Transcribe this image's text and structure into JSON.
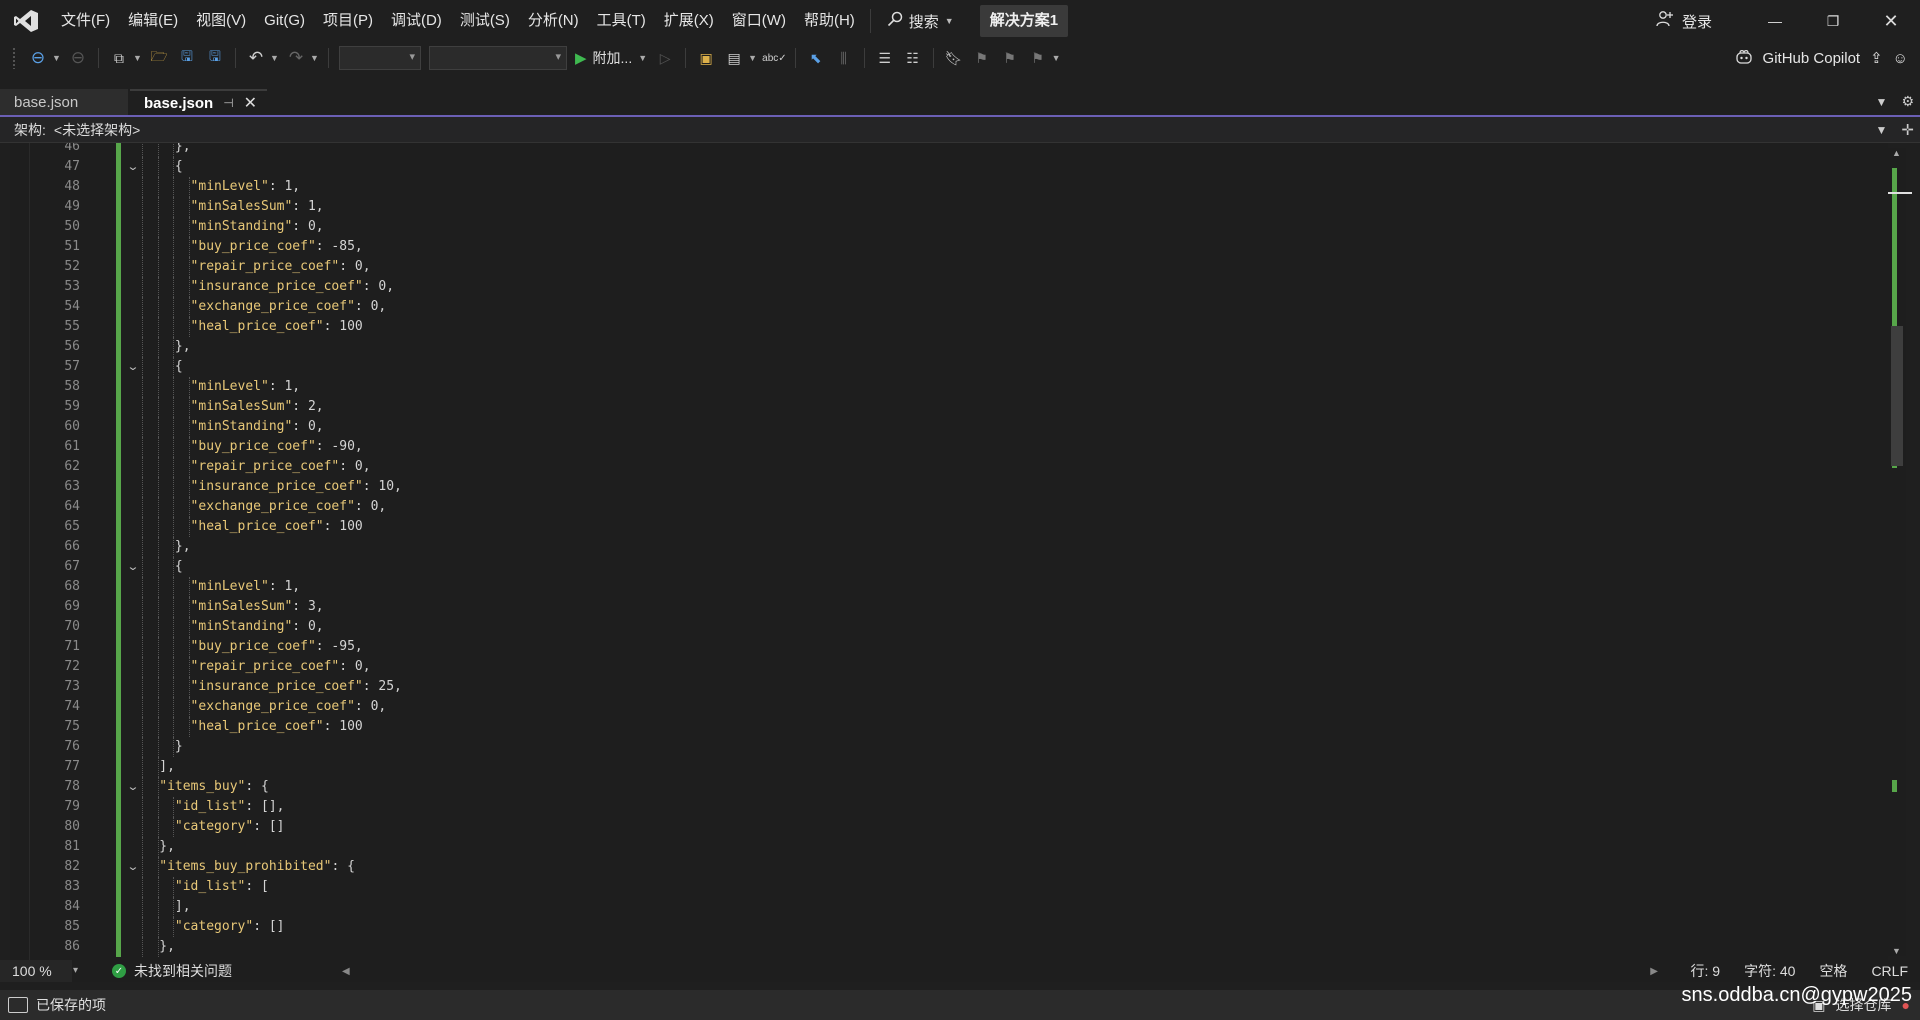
{
  "menu": {
    "items": [
      "文件(F)",
      "编辑(E)",
      "视图(V)",
      "Git(G)",
      "项目(P)",
      "调试(D)",
      "测试(S)",
      "分析(N)",
      "工具(T)",
      "扩展(X)",
      "窗口(W)",
      "帮助(H)"
    ],
    "search_label": "搜索",
    "solution_name": "解决方案1",
    "login_label": "登录"
  },
  "toolbar": {
    "attach_label": "附加...",
    "copilot_label": "GitHub Copilot"
  },
  "tabs": [
    {
      "label": "base.json",
      "active": false
    },
    {
      "label": "base.json",
      "active": true
    }
  ],
  "navbar": {
    "label": "架构:",
    "value": "<未选择架构>"
  },
  "editor": {
    "lines": [
      {
        "n": "46",
        "depth": 3,
        "fold": false,
        "tokens": [
          [
            "p",
            "},"
          ]
        ]
      },
      {
        "n": "47",
        "depth": 3,
        "fold": true,
        "tokens": [
          [
            "p",
            "{"
          ]
        ]
      },
      {
        "n": "48",
        "depth": 4,
        "fold": false,
        "tokens": [
          [
            "s",
            "\"minLevel\""
          ],
          [
            "p",
            ": 1,"
          ]
        ]
      },
      {
        "n": "49",
        "depth": 4,
        "fold": false,
        "tokens": [
          [
            "s",
            "\"minSalesSum\""
          ],
          [
            "p",
            ": 1,"
          ]
        ]
      },
      {
        "n": "50",
        "depth": 4,
        "fold": false,
        "tokens": [
          [
            "s",
            "\"minStanding\""
          ],
          [
            "p",
            ": 0,"
          ]
        ]
      },
      {
        "n": "51",
        "depth": 4,
        "fold": false,
        "tokens": [
          [
            "s",
            "\"buy_price_coef\""
          ],
          [
            "p",
            ": -85,"
          ]
        ]
      },
      {
        "n": "52",
        "depth": 4,
        "fold": false,
        "tokens": [
          [
            "s",
            "\"repair_price_coef\""
          ],
          [
            "p",
            ": 0,"
          ]
        ]
      },
      {
        "n": "53",
        "depth": 4,
        "fold": false,
        "tokens": [
          [
            "s",
            "\"insurance_price_coef\""
          ],
          [
            "p",
            ": 0,"
          ]
        ]
      },
      {
        "n": "54",
        "depth": 4,
        "fold": false,
        "tokens": [
          [
            "s",
            "\"exchange_price_coef\""
          ],
          [
            "p",
            ": 0,"
          ]
        ]
      },
      {
        "n": "55",
        "depth": 4,
        "fold": false,
        "tokens": [
          [
            "s",
            "\"heal_price_coef\""
          ],
          [
            "p",
            ": 100"
          ]
        ]
      },
      {
        "n": "56",
        "depth": 3,
        "fold": false,
        "tokens": [
          [
            "p",
            "},"
          ]
        ]
      },
      {
        "n": "57",
        "depth": 3,
        "fold": true,
        "tokens": [
          [
            "p",
            "{"
          ]
        ]
      },
      {
        "n": "58",
        "depth": 4,
        "fold": false,
        "tokens": [
          [
            "s",
            "\"minLevel\""
          ],
          [
            "p",
            ": 1,"
          ]
        ]
      },
      {
        "n": "59",
        "depth": 4,
        "fold": false,
        "tokens": [
          [
            "s",
            "\"minSalesSum\""
          ],
          [
            "p",
            ": 2,"
          ]
        ]
      },
      {
        "n": "60",
        "depth": 4,
        "fold": false,
        "tokens": [
          [
            "s",
            "\"minStanding\""
          ],
          [
            "p",
            ": 0,"
          ]
        ]
      },
      {
        "n": "61",
        "depth": 4,
        "fold": false,
        "tokens": [
          [
            "s",
            "\"buy_price_coef\""
          ],
          [
            "p",
            ": -90,"
          ]
        ]
      },
      {
        "n": "62",
        "depth": 4,
        "fold": false,
        "tokens": [
          [
            "s",
            "\"repair_price_coef\""
          ],
          [
            "p",
            ": 0,"
          ]
        ]
      },
      {
        "n": "63",
        "depth": 4,
        "fold": false,
        "tokens": [
          [
            "s",
            "\"insurance_price_coef\""
          ],
          [
            "p",
            ": 10,"
          ]
        ]
      },
      {
        "n": "64",
        "depth": 4,
        "fold": false,
        "tokens": [
          [
            "s",
            "\"exchange_price_coef\""
          ],
          [
            "p",
            ": 0,"
          ]
        ]
      },
      {
        "n": "65",
        "depth": 4,
        "fold": false,
        "tokens": [
          [
            "s",
            "\"heal_price_coef\""
          ],
          [
            "p",
            ": 100"
          ]
        ]
      },
      {
        "n": "66",
        "depth": 3,
        "fold": false,
        "tokens": [
          [
            "p",
            "},"
          ]
        ]
      },
      {
        "n": "67",
        "depth": 3,
        "fold": true,
        "tokens": [
          [
            "p",
            "{"
          ]
        ]
      },
      {
        "n": "68",
        "depth": 4,
        "fold": false,
        "tokens": [
          [
            "s",
            "\"minLevel\""
          ],
          [
            "p",
            ": 1,"
          ]
        ]
      },
      {
        "n": "69",
        "depth": 4,
        "fold": false,
        "tokens": [
          [
            "s",
            "\"minSalesSum\""
          ],
          [
            "p",
            ": 3,"
          ]
        ]
      },
      {
        "n": "70",
        "depth": 4,
        "fold": false,
        "tokens": [
          [
            "s",
            "\"minStanding\""
          ],
          [
            "p",
            ": 0,"
          ]
        ]
      },
      {
        "n": "71",
        "depth": 4,
        "fold": false,
        "tokens": [
          [
            "s",
            "\"buy_price_coef\""
          ],
          [
            "p",
            ": -95,"
          ]
        ]
      },
      {
        "n": "72",
        "depth": 4,
        "fold": false,
        "tokens": [
          [
            "s",
            "\"repair_price_coef\""
          ],
          [
            "p",
            ": 0,"
          ]
        ]
      },
      {
        "n": "73",
        "depth": 4,
        "fold": false,
        "tokens": [
          [
            "s",
            "\"insurance_price_coef\""
          ],
          [
            "p",
            ": 25,"
          ]
        ]
      },
      {
        "n": "74",
        "depth": 4,
        "fold": false,
        "tokens": [
          [
            "s",
            "\"exchange_price_coef\""
          ],
          [
            "p",
            ": 0,"
          ]
        ]
      },
      {
        "n": "75",
        "depth": 4,
        "fold": false,
        "tokens": [
          [
            "s",
            "\"heal_price_coef\""
          ],
          [
            "p",
            ": 100"
          ]
        ]
      },
      {
        "n": "76",
        "depth": 3,
        "fold": false,
        "tokens": [
          [
            "p",
            "}"
          ]
        ]
      },
      {
        "n": "77",
        "depth": 2,
        "fold": false,
        "tokens": [
          [
            "p",
            "],"
          ]
        ]
      },
      {
        "n": "78",
        "depth": 2,
        "fold": true,
        "tokens": [
          [
            "s",
            "\"items_buy\""
          ],
          [
            "p",
            ": {"
          ]
        ]
      },
      {
        "n": "79",
        "depth": 3,
        "fold": false,
        "tokens": [
          [
            "s",
            "\"id_list\""
          ],
          [
            "p",
            ": [],"
          ]
        ]
      },
      {
        "n": "80",
        "depth": 3,
        "fold": false,
        "tokens": [
          [
            "s",
            "\"category\""
          ],
          [
            "p",
            ": []"
          ]
        ]
      },
      {
        "n": "81",
        "depth": 2,
        "fold": false,
        "tokens": [
          [
            "p",
            "},"
          ]
        ]
      },
      {
        "n": "82",
        "depth": 2,
        "fold": true,
        "tokens": [
          [
            "s",
            "\"items_buy_prohibited\""
          ],
          [
            "p",
            ": {"
          ]
        ]
      },
      {
        "n": "83",
        "depth": 3,
        "fold": false,
        "tokens": [
          [
            "s",
            "\"id_list\""
          ],
          [
            "p",
            ": ["
          ]
        ]
      },
      {
        "n": "84",
        "depth": 3,
        "fold": false,
        "tokens": [
          [
            "p",
            "],"
          ]
        ]
      },
      {
        "n": "85",
        "depth": 3,
        "fold": false,
        "tokens": [
          [
            "s",
            "\"category\""
          ],
          [
            "p",
            ": []"
          ]
        ]
      },
      {
        "n": "86",
        "depth": 2,
        "fold": false,
        "tokens": [
          [
            "p",
            "},"
          ]
        ]
      }
    ]
  },
  "editor_status": {
    "zoom": "100 %",
    "issues": "未找到相关问题",
    "line": "行: 9",
    "char": "字符: 40",
    "whitespace": "空格",
    "line_ending": "CRLF"
  },
  "statusbar": {
    "saved": "已保存的项",
    "right_label": "选择仓库"
  },
  "watermark": "sns.oddba.cn@gypw2025",
  "colors": {
    "background": "#1f1f1f",
    "editor_bg": "#1e1e1e",
    "string": "#e8c878",
    "change_bar": "#57a64a",
    "accent": "#6b5fb5"
  }
}
